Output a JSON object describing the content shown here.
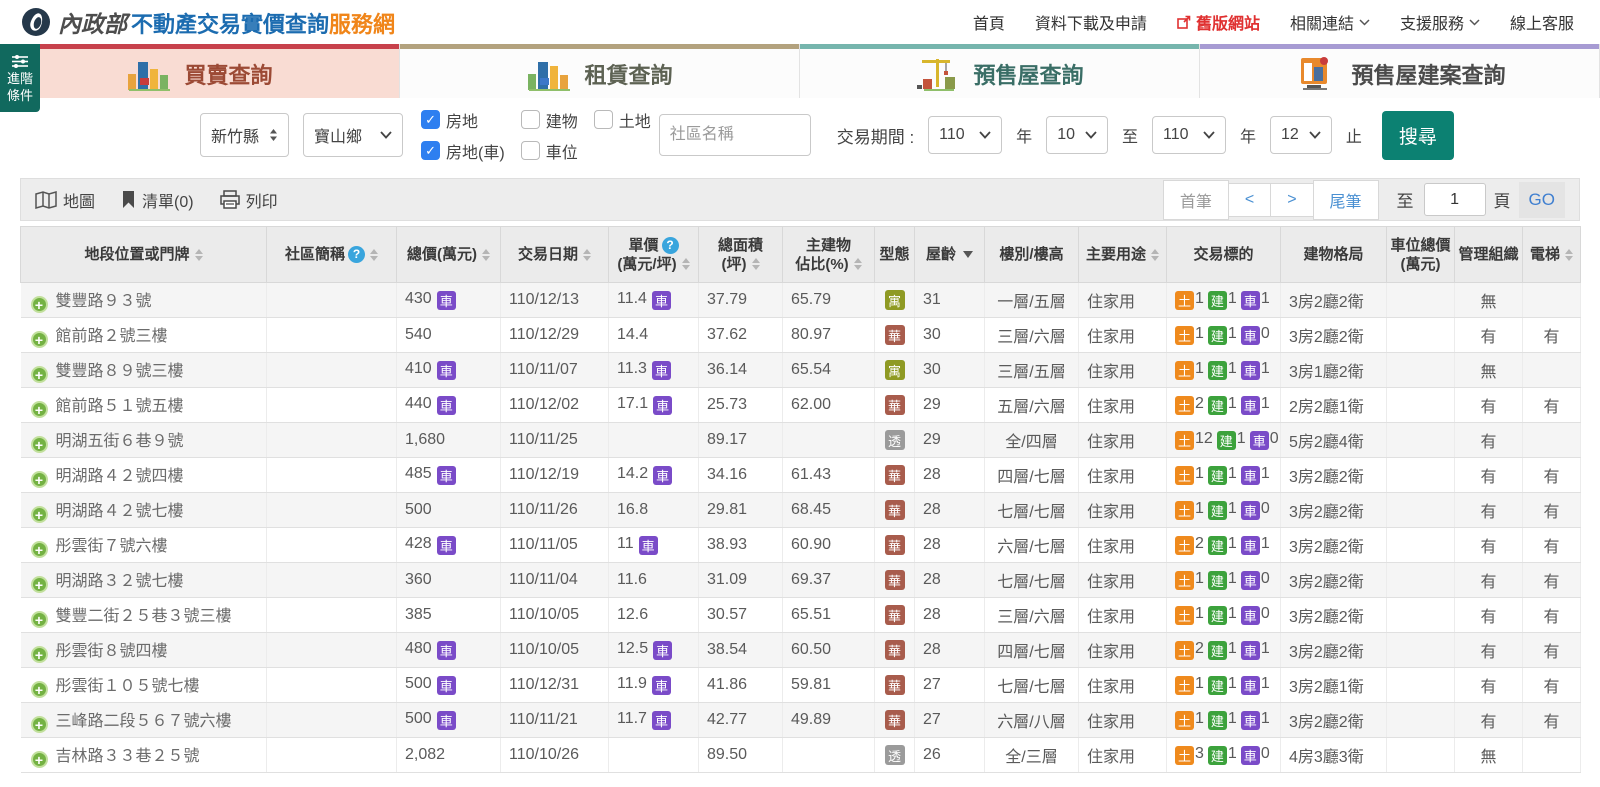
{
  "brand": {
    "ministry": "內政部",
    "title_blue": "不動產交易實價查詢",
    "title_orange": "服務網"
  },
  "top_nav": {
    "items": [
      {
        "label": "首頁"
      },
      {
        "label": "資料下載及申請"
      },
      {
        "label": "舊版網站",
        "highlight": true
      },
      {
        "label": "相關連結",
        "caret": true
      },
      {
        "label": "支援服務",
        "caret": true
      },
      {
        "label": "線上客服"
      }
    ]
  },
  "advanced_button": {
    "line1": "進階",
    "line2": "條件"
  },
  "tabs": [
    {
      "label": "買賣查詢",
      "active": true
    },
    {
      "label": "租賃查詢",
      "active": false
    },
    {
      "label": "預售屋查詢",
      "active": false
    },
    {
      "label": "預售屋建案查詢",
      "active": false
    }
  ],
  "filters": {
    "county": "新竹縣",
    "district": "寶山鄉",
    "checkboxes": [
      {
        "label": "房地",
        "checked": true
      },
      {
        "label": "建物",
        "checked": false
      },
      {
        "label": "土地",
        "checked": false
      },
      {
        "label": "房地(車)",
        "checked": true
      },
      {
        "label": "車位",
        "checked": false
      }
    ],
    "community_placeholder": "社區名稱",
    "period_label": "交易期間 :",
    "year_from": "110",
    "month_from": "10",
    "year_to": "110",
    "month_to": "12",
    "year_label": "年",
    "to_label": "至",
    "end_label": "止",
    "search_label": "搜尋",
    "check_glyph": "✓"
  },
  "toolbar": {
    "map": "地圖",
    "list": "清單(0)",
    "print": "列印"
  },
  "pagination": {
    "first": "首筆",
    "prev": "<",
    "next": ">",
    "last": "尾筆",
    "to": "至",
    "page_value": "1",
    "page": "頁",
    "go": "GO"
  },
  "badges": {
    "car": "車",
    "land": "土",
    "build": "建"
  },
  "table": {
    "columns": [
      {
        "label": "地段位置或門牌",
        "sort": true
      },
      {
        "label": "社區簡稱",
        "help": true,
        "sort": true
      },
      {
        "label": "總價(萬元)",
        "sort": true
      },
      {
        "label": "交易日期",
        "sort": true
      },
      {
        "label": "單價",
        "sub": "(萬元/坪)",
        "help": true,
        "sort": true
      },
      {
        "label": "總面積",
        "sub": "(坪)",
        "sort": true
      },
      {
        "label": "主建物",
        "sub": "佔比(%)",
        "sort": true
      },
      {
        "label": "型態"
      },
      {
        "label": "屋齡",
        "sorted": "desc"
      },
      {
        "label": "樓別/樓高"
      },
      {
        "label": "主要用途",
        "sort": true
      },
      {
        "label": "交易標的"
      },
      {
        "label": "建物格局"
      },
      {
        "label": "車位總價",
        "sub": "(萬元)"
      },
      {
        "label": "管理組織"
      },
      {
        "label": "電梯",
        "sort": true
      }
    ],
    "rows": [
      {
        "address": "雙豐路９３號",
        "community": "",
        "total_price": "430",
        "total_car": true,
        "date": "110/12/13",
        "unit_price": "11.4",
        "unit_car": true,
        "area": "37.79",
        "ratio": "65.79",
        "type": "寓",
        "age": "31",
        "floor": "一層/五層",
        "usage": "住家用",
        "land": "1",
        "build": "1",
        "car": "1",
        "layout": "3房2廳2衛",
        "parking_price": "",
        "mgmt": "無",
        "elevator": ""
      },
      {
        "address": "館前路２號三樓",
        "community": "",
        "total_price": "540",
        "total_car": false,
        "date": "110/12/29",
        "unit_price": "14.4",
        "unit_car": false,
        "area": "37.62",
        "ratio": "80.97",
        "type": "華",
        "age": "30",
        "floor": "三層/六層",
        "usage": "住家用",
        "land": "1",
        "build": "1",
        "car": "0",
        "layout": "3房2廳2衛",
        "parking_price": "",
        "mgmt": "有",
        "elevator": "有"
      },
      {
        "address": "雙豐路８９號三樓",
        "community": "",
        "total_price": "410",
        "total_car": true,
        "date": "110/11/07",
        "unit_price": "11.3",
        "unit_car": true,
        "area": "36.14",
        "ratio": "65.54",
        "type": "寓",
        "age": "30",
        "floor": "三層/五層",
        "usage": "住家用",
        "land": "1",
        "build": "1",
        "car": "1",
        "layout": "3房1廳2衛",
        "parking_price": "",
        "mgmt": "無",
        "elevator": ""
      },
      {
        "address": "館前路５１號五樓",
        "community": "",
        "total_price": "440",
        "total_car": true,
        "date": "110/12/02",
        "unit_price": "17.1",
        "unit_car": true,
        "area": "25.73",
        "ratio": "62.00",
        "type": "華",
        "age": "29",
        "floor": "五層/六層",
        "usage": "住家用",
        "land": "2",
        "build": "1",
        "car": "1",
        "layout": "2房2廳1衛",
        "parking_price": "",
        "mgmt": "有",
        "elevator": "有"
      },
      {
        "address": "明湖五街６巷９號",
        "community": "",
        "total_price": "1,680",
        "total_car": false,
        "date": "110/11/25",
        "unit_price": "",
        "unit_car": false,
        "area": "89.17",
        "ratio": "",
        "type": "透",
        "age": "29",
        "floor": "全/四層",
        "usage": "住家用",
        "land": "12",
        "build": "1",
        "car": "0",
        "layout": "5房2廳4衛",
        "parking_price": "",
        "mgmt": "有",
        "elevator": ""
      },
      {
        "address": "明湖路４２號四樓",
        "community": "",
        "total_price": "485",
        "total_car": true,
        "date": "110/12/19",
        "unit_price": "14.2",
        "unit_car": true,
        "area": "34.16",
        "ratio": "61.43",
        "type": "華",
        "age": "28",
        "floor": "四層/七層",
        "usage": "住家用",
        "land": "1",
        "build": "1",
        "car": "1",
        "layout": "3房2廳2衛",
        "parking_price": "",
        "mgmt": "有",
        "elevator": "有"
      },
      {
        "address": "明湖路４２號七樓",
        "community": "",
        "total_price": "500",
        "total_car": false,
        "date": "110/11/26",
        "unit_price": "16.8",
        "unit_car": false,
        "area": "29.81",
        "ratio": "68.45",
        "type": "華",
        "age": "28",
        "floor": "七層/七層",
        "usage": "住家用",
        "land": "1",
        "build": "1",
        "car": "0",
        "layout": "3房2廳2衛",
        "parking_price": "",
        "mgmt": "有",
        "elevator": "有"
      },
      {
        "address": "彤雲街７號六樓",
        "community": "",
        "total_price": "428",
        "total_car": true,
        "date": "110/11/05",
        "unit_price": "11",
        "unit_car": true,
        "area": "38.93",
        "ratio": "60.90",
        "type": "華",
        "age": "28",
        "floor": "六層/七層",
        "usage": "住家用",
        "land": "2",
        "build": "1",
        "car": "1",
        "layout": "3房2廳2衛",
        "parking_price": "",
        "mgmt": "有",
        "elevator": "有"
      },
      {
        "address": "明湖路３２號七樓",
        "community": "",
        "total_price": "360",
        "total_car": false,
        "date": "110/11/04",
        "unit_price": "11.6",
        "unit_car": false,
        "area": "31.09",
        "ratio": "69.37",
        "type": "華",
        "age": "28",
        "floor": "七層/七層",
        "usage": "住家用",
        "land": "1",
        "build": "1",
        "car": "0",
        "layout": "3房2廳2衛",
        "parking_price": "",
        "mgmt": "有",
        "elevator": "有"
      },
      {
        "address": "雙豐二街２５巷３號三樓",
        "community": "",
        "total_price": "385",
        "total_car": false,
        "date": "110/10/05",
        "unit_price": "12.6",
        "unit_car": false,
        "area": "30.57",
        "ratio": "65.51",
        "type": "華",
        "age": "28",
        "floor": "三層/六層",
        "usage": "住家用",
        "land": "1",
        "build": "1",
        "car": "0",
        "layout": "3房2廳2衛",
        "parking_price": "",
        "mgmt": "有",
        "elevator": "有"
      },
      {
        "address": "彤雲街８號四樓",
        "community": "",
        "total_price": "480",
        "total_car": true,
        "date": "110/10/05",
        "unit_price": "12.5",
        "unit_car": true,
        "area": "38.54",
        "ratio": "60.50",
        "type": "華",
        "age": "28",
        "floor": "四層/七層",
        "usage": "住家用",
        "land": "2",
        "build": "1",
        "car": "1",
        "layout": "3房2廳2衛",
        "parking_price": "",
        "mgmt": "有",
        "elevator": "有"
      },
      {
        "address": "彤雲街１０５號七樓",
        "community": "",
        "total_price": "500",
        "total_car": true,
        "date": "110/12/31",
        "unit_price": "11.9",
        "unit_car": true,
        "area": "41.86",
        "ratio": "59.81",
        "type": "華",
        "age": "27",
        "floor": "七層/七層",
        "usage": "住家用",
        "land": "1",
        "build": "1",
        "car": "1",
        "layout": "3房2廳1衛",
        "parking_price": "",
        "mgmt": "有",
        "elevator": "有"
      },
      {
        "address": "三峰路二段５６７號六樓",
        "community": "",
        "total_price": "500",
        "total_car": true,
        "date": "110/11/21",
        "unit_price": "11.7",
        "unit_car": true,
        "area": "42.77",
        "ratio": "49.89",
        "type": "華",
        "age": "27",
        "floor": "六層/八層",
        "usage": "住家用",
        "land": "1",
        "build": "1",
        "car": "1",
        "layout": "3房2廳2衛",
        "parking_price": "",
        "mgmt": "有",
        "elevator": "有"
      },
      {
        "address": "吉林路３３巷２５號",
        "community": "",
        "total_price": "2,082",
        "total_car": false,
        "date": "110/10/26",
        "unit_price": "",
        "unit_car": false,
        "area": "89.50",
        "ratio": "",
        "type": "透",
        "age": "26",
        "floor": "全/三層",
        "usage": "住家用",
        "land": "3",
        "build": "1",
        "car": "0",
        "layout": "4房3廳3衛",
        "parking_price": "",
        "mgmt": "無",
        "elevator": ""
      }
    ]
  }
}
